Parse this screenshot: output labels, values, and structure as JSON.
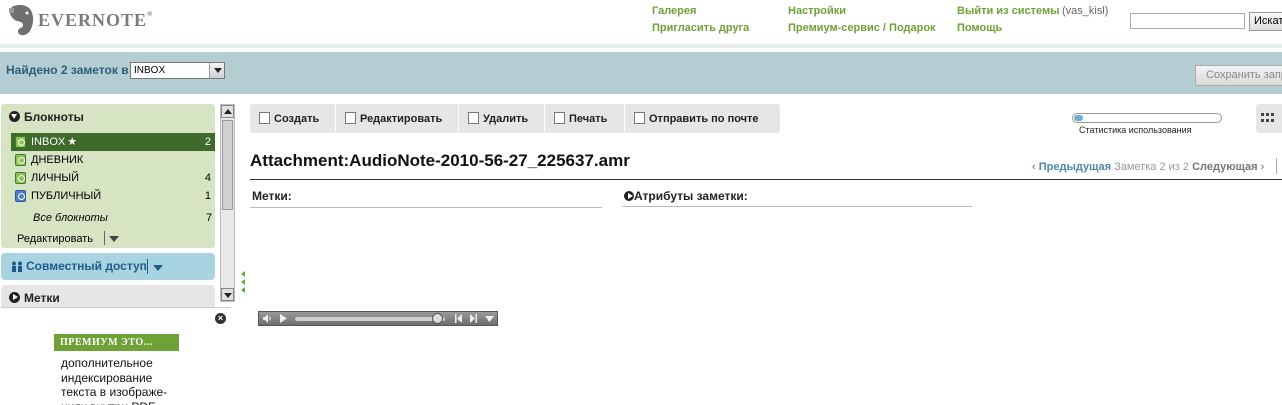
{
  "header": {
    "logo_text": "EVERNOTE",
    "logo_reg": "®",
    "links": {
      "gallery": "Галерея",
      "invite": "Пригласить друга",
      "settings": "Настройки",
      "premium": "Премиум-сервис / Подарок",
      "logout": "Выйти из системы",
      "help": "Помощь"
    },
    "username": "(vas_kisl)",
    "search_value": "",
    "search_button": "Искать"
  },
  "searchbar": {
    "found_label": "Найдено 2 заметок в",
    "notebook_selected": "INBOX",
    "save_search": "Сохранить запрос"
  },
  "sidebar": {
    "notebooks_title": "Блокноты",
    "notebooks": [
      {
        "name": "INBOX",
        "count": "2",
        "star": "★"
      },
      {
        "name": "ДНЕВНИК",
        "count": ""
      },
      {
        "name": "ЛИЧНЫЙ",
        "count": "4"
      },
      {
        "name": "ПУБЛИЧНЫЙ",
        "count": "1"
      }
    ],
    "all_notebooks": "Все блокноты",
    "all_count": "7",
    "edit_label": "Редактировать",
    "shared_label": "Совместный доступ",
    "tags_title": "Метки"
  },
  "promo": {
    "badge": "ПРЕМИУМ ЭТО...",
    "close": "×",
    "text": "дополнительное индексирование текста в изображе-ниях внутри PDF"
  },
  "toolbar": {
    "create": "Создать",
    "edit": "Редактировать",
    "delete": "Удалить",
    "print": "Печать",
    "email": "Отправить по почте"
  },
  "usage": {
    "label": "Статистика использования",
    "fraction": 0.06
  },
  "note": {
    "title": "Attachment:AudioNote-2010-56-27_225637.amr",
    "tags_label": "Метки:",
    "attributes_label": "Атрибуты заметки:"
  },
  "pager": {
    "prev": "Предыдущая",
    "position": "Заметка 2 из 2",
    "next": "Следующая"
  },
  "player": {
    "progress": 0.95
  },
  "icons": {
    "logo": "elephant-logo-icon",
    "notebook": "sync-notebook-icon",
    "public": "public-notebook-icon",
    "shared": "people-icon",
    "create": "new-note-icon",
    "edit": "edit-note-icon",
    "delete": "delete-note-icon",
    "print": "printer-icon",
    "email": "email-icon",
    "grid": "grid-view-icon"
  },
  "colors": {
    "accent_green": "#6ea136",
    "search_band": "#b3cdd3",
    "notebook_panel": "#d6e4c3",
    "shared_panel": "#a8d4e2",
    "selected_row": "#3e6b2b"
  }
}
